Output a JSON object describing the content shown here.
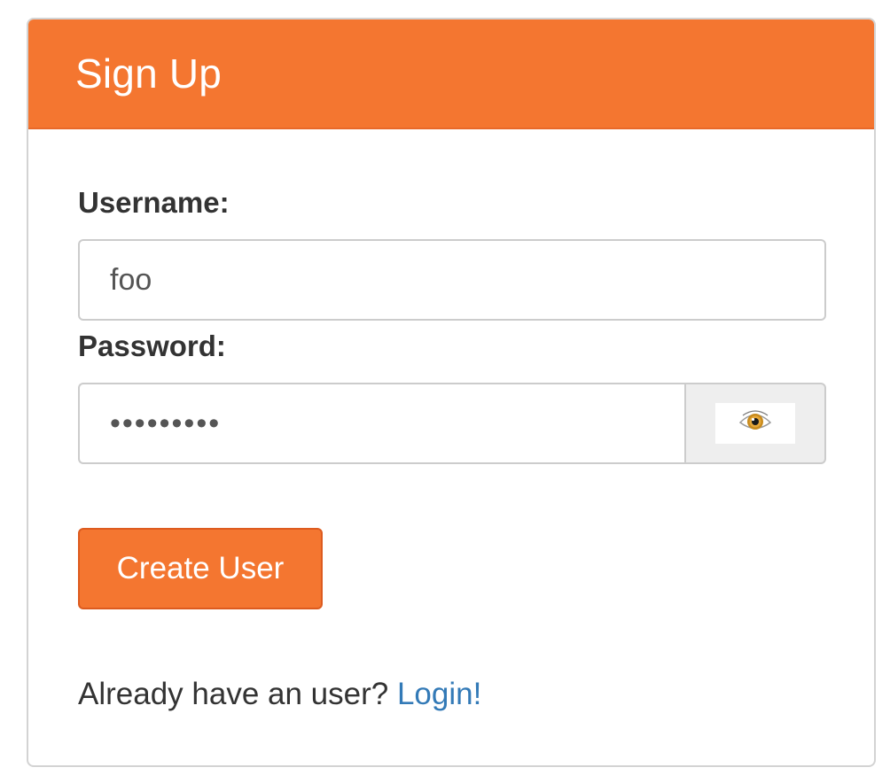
{
  "header": {
    "title": "Sign Up"
  },
  "form": {
    "username_label": "Username:",
    "username_value": "foo",
    "password_label": "Password:",
    "password_value": "•••••••••",
    "password_toggle_icon": "eye-icon",
    "submit_label": "Create User"
  },
  "footer": {
    "prompt": "Already have an user?",
    "login_link": "Login!"
  },
  "colors": {
    "accent": "#f47630",
    "link": "#337ab7"
  }
}
